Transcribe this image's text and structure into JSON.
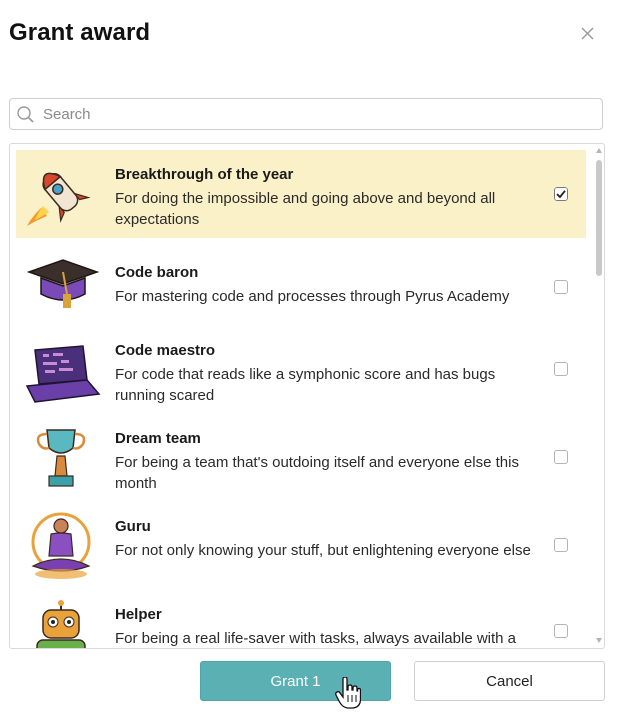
{
  "dialog": {
    "title": "Grant award",
    "close_icon": "close-icon"
  },
  "search": {
    "placeholder": "Search",
    "value": "",
    "icon": "search-icon"
  },
  "awards": [
    {
      "name": "Breakthrough of the year",
      "description": "For doing the impossible and going above and beyond all expectations",
      "selected": true,
      "icon": "rocket-icon"
    },
    {
      "name": "Code baron",
      "description": "For mastering code and processes through Pyrus Academy",
      "selected": false,
      "icon": "graduation-cap-icon"
    },
    {
      "name": "Code maestro",
      "description": "For code that reads like a symphonic score and has bugs running scared",
      "selected": false,
      "icon": "laptop-icon"
    },
    {
      "name": "Dream team",
      "description": "For being a team that's outdoing itself and everyone else this month",
      "selected": false,
      "icon": "trophy-icon"
    },
    {
      "name": "Guru",
      "description": "For not only knowing your stuff, but enlightening everyone else",
      "selected": false,
      "icon": "meditating-guru-icon"
    },
    {
      "name": "Helper",
      "description": "For being a real life-saver with tasks, always available with a",
      "selected": false,
      "icon": "robot-icon"
    }
  ],
  "colors": {
    "selected_row": "#fbf1c8",
    "primary_button": "#5ab0b2"
  },
  "footer": {
    "grant_label": "Grant 1",
    "cancel_label": "Cancel"
  }
}
